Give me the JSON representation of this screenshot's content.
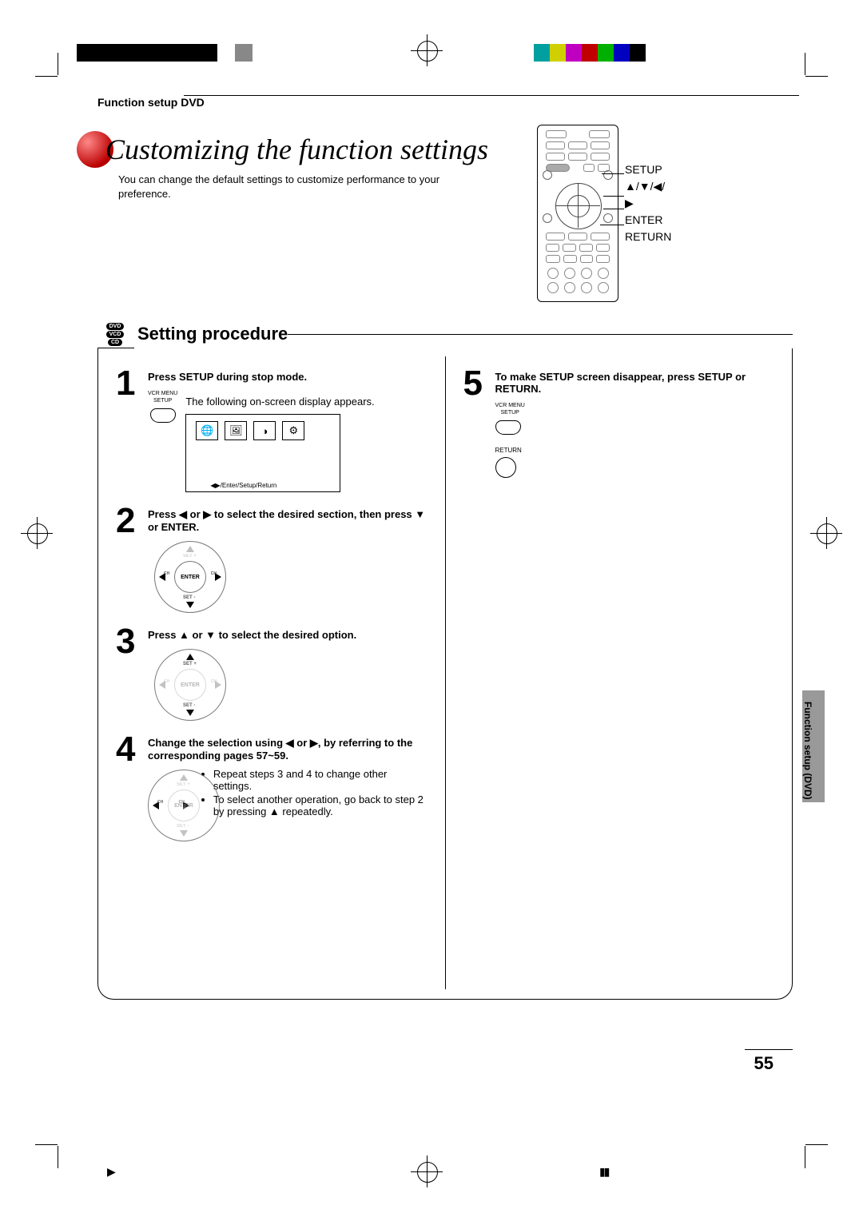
{
  "colors": {
    "bw": [
      "#000",
      "#000",
      "#000",
      "#000",
      "#000",
      "#000",
      "#000",
      "#000",
      "#fff",
      "#888"
    ],
    "bars": [
      "#00a0a0",
      "#d0d000",
      "#c000c0",
      "#c00000",
      "#00b000",
      "#0000c0",
      "#000000"
    ]
  },
  "header": "Function setup DVD",
  "title": "Customizing the function settings",
  "subtitle": "You can change the default settings to customize performance to your preference.",
  "remote_labels": [
    "SETUP",
    "▲/▼/◀/▶",
    "ENTER",
    "RETURN"
  ],
  "section": {
    "tags": [
      "DVD",
      "VCD",
      "CD"
    ],
    "title": "Setting procedure"
  },
  "side_label": "Function setup (DVD)",
  "page_number": "55",
  "steps": {
    "s1": {
      "num": "1",
      "bold": "Press SETUP during stop mode.",
      "btn_label_top": "VCR MENU",
      "btn_label_bot": "SETUP",
      "desc": "The following on-screen display appears.",
      "osd_icons": [
        "🌐",
        "🖼",
        "◑",
        "⚙"
      ],
      "osd_foot": "◀▶/Enter/Setup/Return"
    },
    "s2": {
      "num": "2",
      "bold": "Press ◀ or ▶ to select the desired section, then press ▼ or ENTER.",
      "enter": "ENTER"
    },
    "s3": {
      "num": "3",
      "bold": "Press ▲ or ▼ to select the desired option."
    },
    "s4": {
      "num": "4",
      "bold": "Change the selection using ◀ or ▶, by referring to the corresponding pages 57~59.",
      "bullets": [
        "Repeat steps 3 and 4 to change other settings.",
        "To select another operation, go back to step 2 by pressing ▲ repeatedly."
      ]
    },
    "s5": {
      "num": "5",
      "bold": "To make SETUP screen disappear, press SETUP or RETURN.",
      "btn_label_top": "VCR MENU",
      "btn_label_bot": "SETUP",
      "return_label": "RETURN"
    }
  }
}
